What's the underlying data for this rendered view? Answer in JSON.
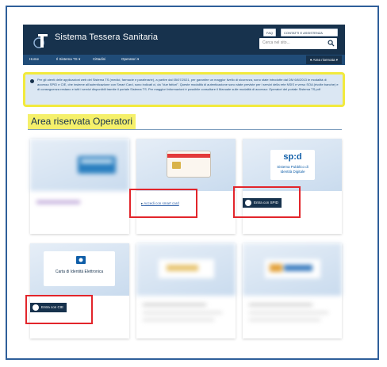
{
  "header": {
    "title": "Sistema Tessera Sanitaria",
    "faq_label": "FAQ",
    "contact_label": "CONTATTI E ASSISTENZA",
    "search_placeholder": "Cerca nel sito..."
  },
  "nav": {
    "items": [
      "Home",
      "Il Sistema TS",
      "Cittadini",
      "Operatori"
    ],
    "area_button": "Area riservata"
  },
  "notice": {
    "text": "Per gli utenti delle applicazioni web del Sistema TS (medici, farmacie e paraferarie), a partire dal 05/07/2021, per garantire un maggior livello di sicurezza, sono state introdotte dal DM 6/6/2013 le modalità di accesso SPID e CIE, che insieme all'autenticazione con Smart Card, sono indicati ci, da \"due fattori\". Queste modalità di autenticazione sono state previste per i servizi della rete NSIS e verso SOA (rivolte banche) e di conseguenza restano e tutti i servizi disponibili tramite il portale Sistema TS. Per maggiori informazioni è possibile consultare il Manuale sulle modalità di accesso: Operatori del portale Sistema TS.pdf"
  },
  "page": {
    "section_title": "Area riservata Operatori"
  },
  "cards": {
    "smartcard_link": "Accedi con smart card",
    "spid_logo": "sp:d",
    "spid_subtitle": "Sistema Pubblico di Identità Digitale",
    "spid_button": "Entra con SPID",
    "cie_card_label": "Carta di Identità Elettronica",
    "cie_button": "Entra con CIE"
  },
  "icons": [
    "logo-icon",
    "search-icon",
    "info-icon",
    "chevron-down-icon",
    "user-icon",
    "spid-user-icon",
    "cie-icon"
  ],
  "colors": {
    "header": "#17324d",
    "nav": "#204c78",
    "highlight": "#f5f06a",
    "notice_border": "#f2ea3d",
    "annotation_red": "#e2252b"
  }
}
